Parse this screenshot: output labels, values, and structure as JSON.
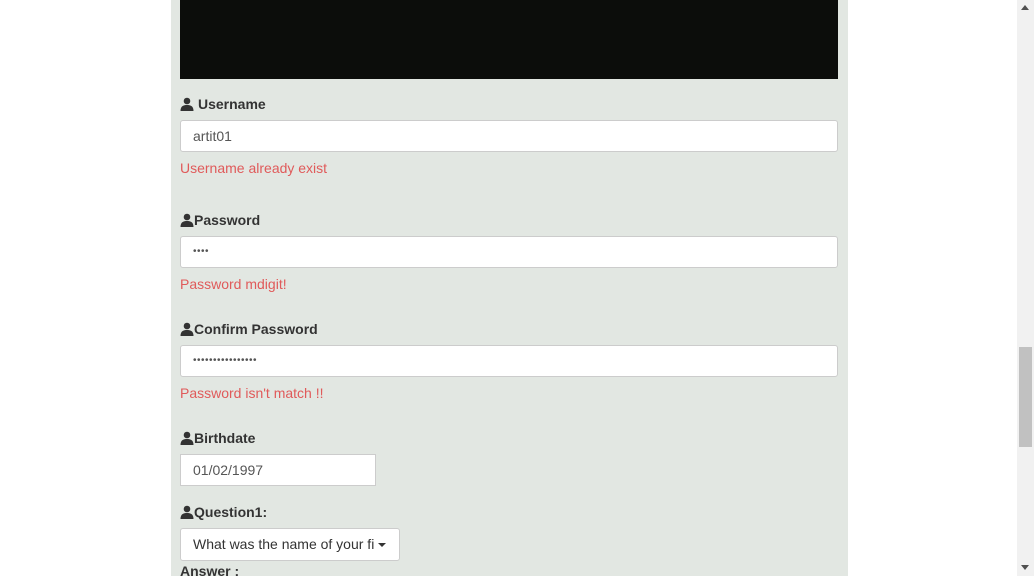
{
  "form": {
    "username": {
      "label": "Username",
      "value": "artit01",
      "error": "Username already exist"
    },
    "password": {
      "label": "Password",
      "value": "••••",
      "error": "Password mdigit!"
    },
    "confirm_password": {
      "label": "Confirm Password",
      "value": "••••••••••••••••",
      "error": "Password isn't match !!"
    },
    "birthdate": {
      "label": "Birthdate",
      "value": "01/02/1997"
    },
    "question1": {
      "label": "Question1:",
      "selected": "What was the name of your fi"
    },
    "answer": {
      "label": "Answer :"
    }
  },
  "icons": {
    "field_icon": "user-icon"
  },
  "colors": {
    "panel_bg": "#e2e7e2",
    "error": "#e05a5a",
    "banner": "#0c0d0b"
  }
}
